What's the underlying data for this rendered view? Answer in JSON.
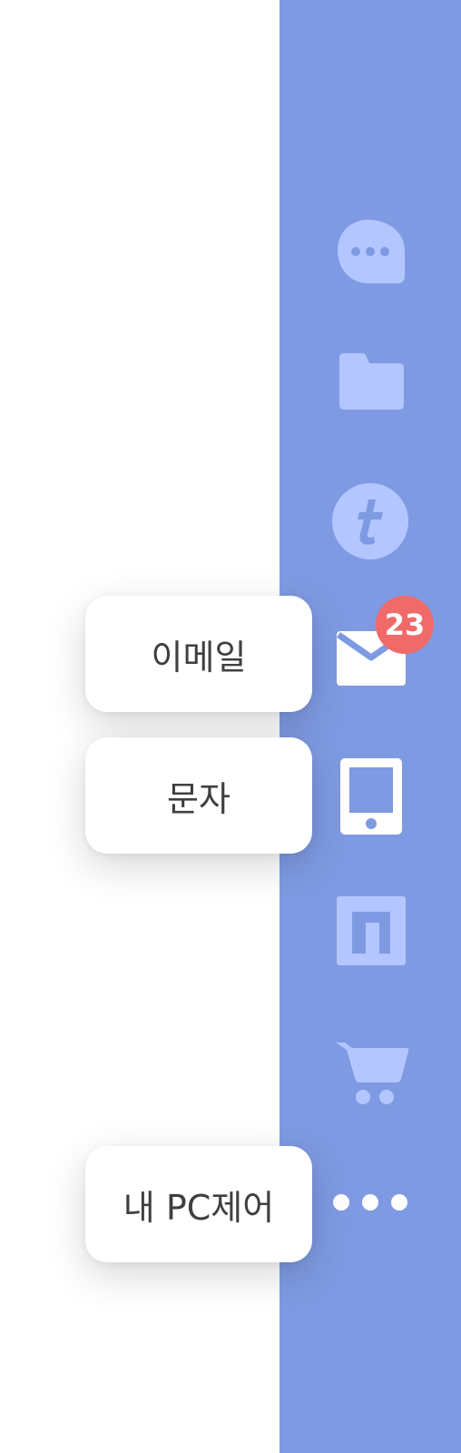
{
  "sidebar": {
    "accent_color": "#7e9ae2",
    "icon_color_inactive": "#b4c6ff",
    "icon_color_active": "#ffffff",
    "items": [
      {
        "icon": "chat-bubble-icon",
        "active": false
      },
      {
        "icon": "folder-icon",
        "active": false
      },
      {
        "icon": "tistory-icon",
        "active": false
      },
      {
        "icon": "mail-icon",
        "active": true,
        "badge": "23"
      },
      {
        "icon": "tablet-icon",
        "active": true
      },
      {
        "icon": "n-square-icon",
        "active": false
      },
      {
        "icon": "cart-icon",
        "active": false
      },
      {
        "icon": "more-icon",
        "active": true
      }
    ]
  },
  "badge": {
    "color": "#f06a6a"
  },
  "tooltips": {
    "email": "이메일",
    "sms": "문자",
    "pc_control": "내 PC제어"
  }
}
